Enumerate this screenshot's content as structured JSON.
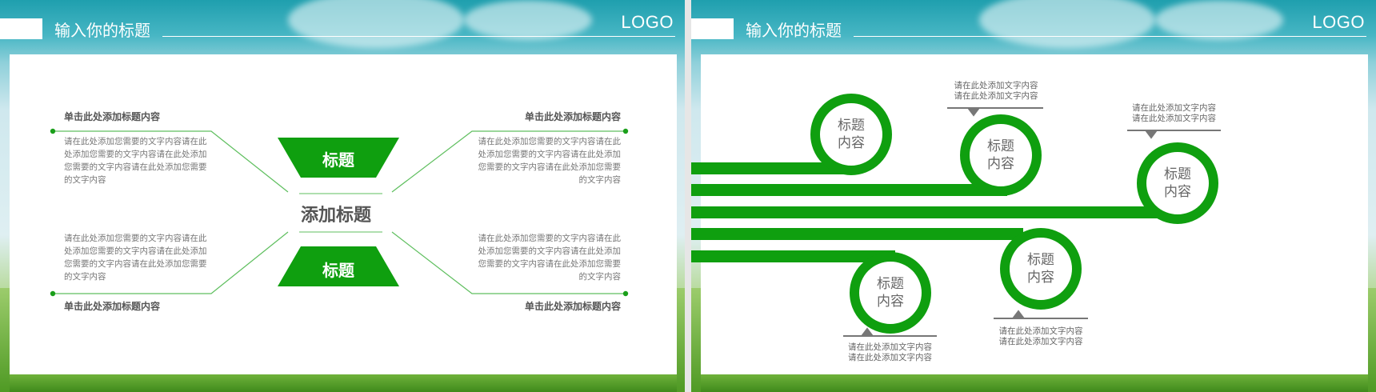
{
  "slide_left": {
    "header": {
      "title": "输入你的标题",
      "logo": "LOGO"
    },
    "center_title": "添加标题",
    "top_trapezoid_label": "标题",
    "bottom_trapezoid_label": "标题",
    "top_left": {
      "heading": "单击此处添加标题内容",
      "body": "请在此处添加您需要的文字内容请在此处添加您需要的文字内容请在此处添加您需要的文字内容请在此处添加您需要的文字内容"
    },
    "top_right": {
      "heading": "单击此处添加标题内容",
      "body": "请在此处添加您需要的文字内容请在此处添加您需要的文字内容请在此处添加您需要的文字内容请在此处添加您需要的文字内容"
    },
    "bottom_left": {
      "heading": "单击此处添加标题内容",
      "body": "请在此处添加您需要的文字内容请在此处添加您需要的文字内容请在此处添加您需要的文字内容请在此处添加您需要的文字内容"
    },
    "bottom_right": {
      "heading": "单击此处添加标题内容",
      "body": "请在此处添加您需要的文字内容请在此处添加您需要的文字内容请在此处添加您需要的文字内容请在此处添加您需要的文字内容"
    }
  },
  "slide_right": {
    "header": {
      "title": "输入你的标题",
      "logo": "LOGO"
    },
    "circles": [
      {
        "line1": "标题",
        "line2": "内容"
      },
      {
        "line1": "标题",
        "line2": "内容"
      },
      {
        "line1": "标题",
        "line2": "内容"
      },
      {
        "line1": "标题",
        "line2": "内容"
      },
      {
        "line1": "标题",
        "line2": "内容"
      }
    ],
    "notes": [
      {
        "line1": "请在此处添加文字内容",
        "line2": "请在此处添加文字内容"
      },
      {
        "line1": "请在此处添加文字内容",
        "line2": "请在此处添加文字内容"
      },
      {
        "line1": "请在此处添加文字内容",
        "line2": "请在此处添加文字内容"
      },
      {
        "line1": "请在此处添加文字内容",
        "line2": "请在此处添加文字内容"
      }
    ]
  },
  "colors": {
    "green": "#0f9f0f",
    "green_dark": "#0a8a0a",
    "text_gray": "#666666",
    "accent_line": "#5fbf5f"
  }
}
